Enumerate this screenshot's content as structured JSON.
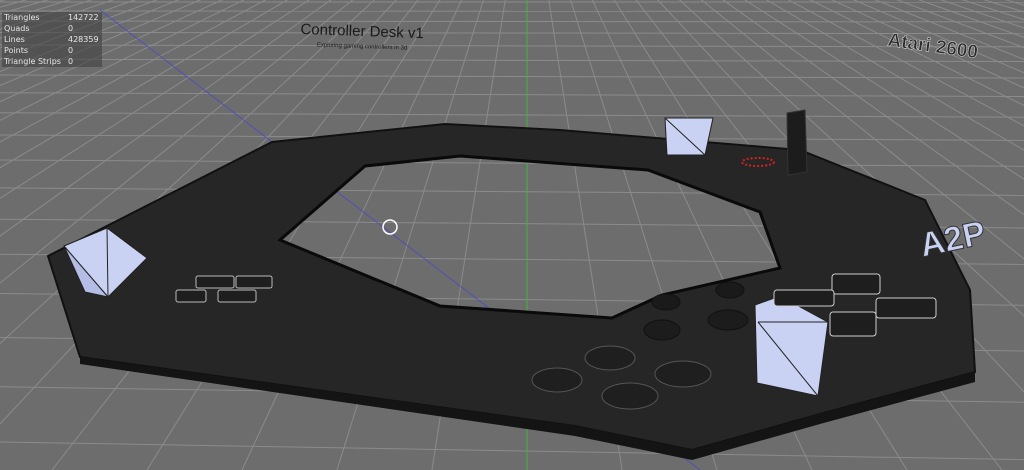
{
  "stats": [
    {
      "label": "Triangles",
      "value": "142722"
    },
    {
      "label": "Quads",
      "value": "0"
    },
    {
      "label": "Lines",
      "value": "428359"
    },
    {
      "label": "Points",
      "value": "0"
    },
    {
      "label": "Triangle Strips",
      "value": "0"
    }
  ],
  "scene": {
    "title": "Controller Desk v1",
    "subtitle": "Exploring gaming controllers in 3d",
    "brand": "Atari 2600",
    "brand_3d": "A2P"
  },
  "colors": {
    "background": "#6e6e6e",
    "grid": "#8a8a8a",
    "desk": "#242424",
    "cube": "#c9d2f2",
    "axis_green": "#3fb83f",
    "axis_blue": "#4a4ac8",
    "button_red": "#d42020"
  }
}
